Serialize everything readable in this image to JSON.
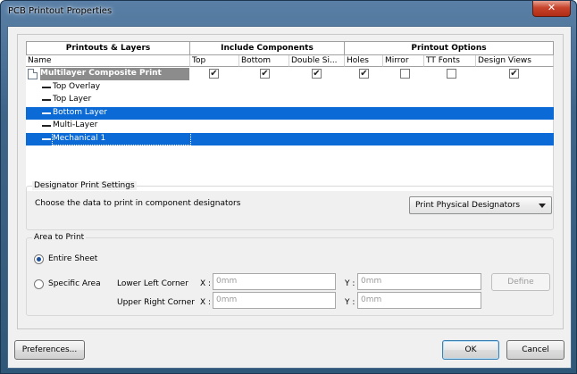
{
  "window": {
    "title": "PCB Printout Properties",
    "close_label": "✕"
  },
  "grid": {
    "group_headers": [
      "Printouts & Layers",
      "Include Components",
      "Printout Options"
    ],
    "columns": [
      "Name",
      "Top",
      "Bottom",
      "Double Si...",
      "Holes",
      "Mirror",
      "TT Fonts",
      "Design Views"
    ],
    "printout": {
      "name": "Multilayer Composite Print",
      "checks": {
        "top": true,
        "bottom": true,
        "double_sided": true,
        "holes": true,
        "mirror": false,
        "tt_fonts": false,
        "design_views": true
      }
    },
    "layers": [
      {
        "name": "Top Overlay",
        "selected": false
      },
      {
        "name": "Top Layer",
        "selected": false
      },
      {
        "name": "Bottom Layer",
        "selected": true
      },
      {
        "name": "Multi-Layer",
        "selected": false
      },
      {
        "name": "Mechanical 1",
        "selected": true
      }
    ]
  },
  "designator": {
    "group_title": "Designator Print Settings",
    "prompt": "Choose the data to print in component designators",
    "selected": "Print Physical Designators"
  },
  "area": {
    "group_title": "Area to Print",
    "entire_sheet": "Entire Sheet",
    "specific_area": "Specific Area",
    "lower_left": "Lower Left Corner",
    "upper_right": "Upper Right Corner",
    "x_label": "X :",
    "y_label": "Y :",
    "placeholder": "0mm",
    "define": "Define"
  },
  "buttons": {
    "preferences": "Preferences...",
    "ok": "OK",
    "cancel": "Cancel"
  }
}
